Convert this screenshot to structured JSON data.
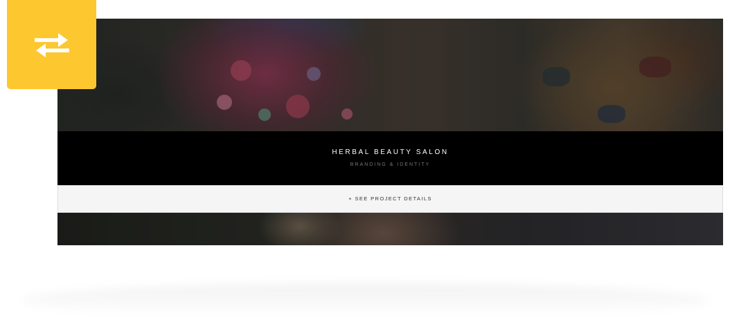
{
  "project": {
    "title": "HERBAL BEAUTY SALON",
    "category": "BRANDING & IDENTITY",
    "details_label": "+ SEE PROJECT DETAILS"
  },
  "colors": {
    "accent": "#fcc72f",
    "caption_background": "#000000",
    "details_background": "#f5f5f5"
  },
  "icons": {
    "swap": "swap-arrows-icon"
  }
}
